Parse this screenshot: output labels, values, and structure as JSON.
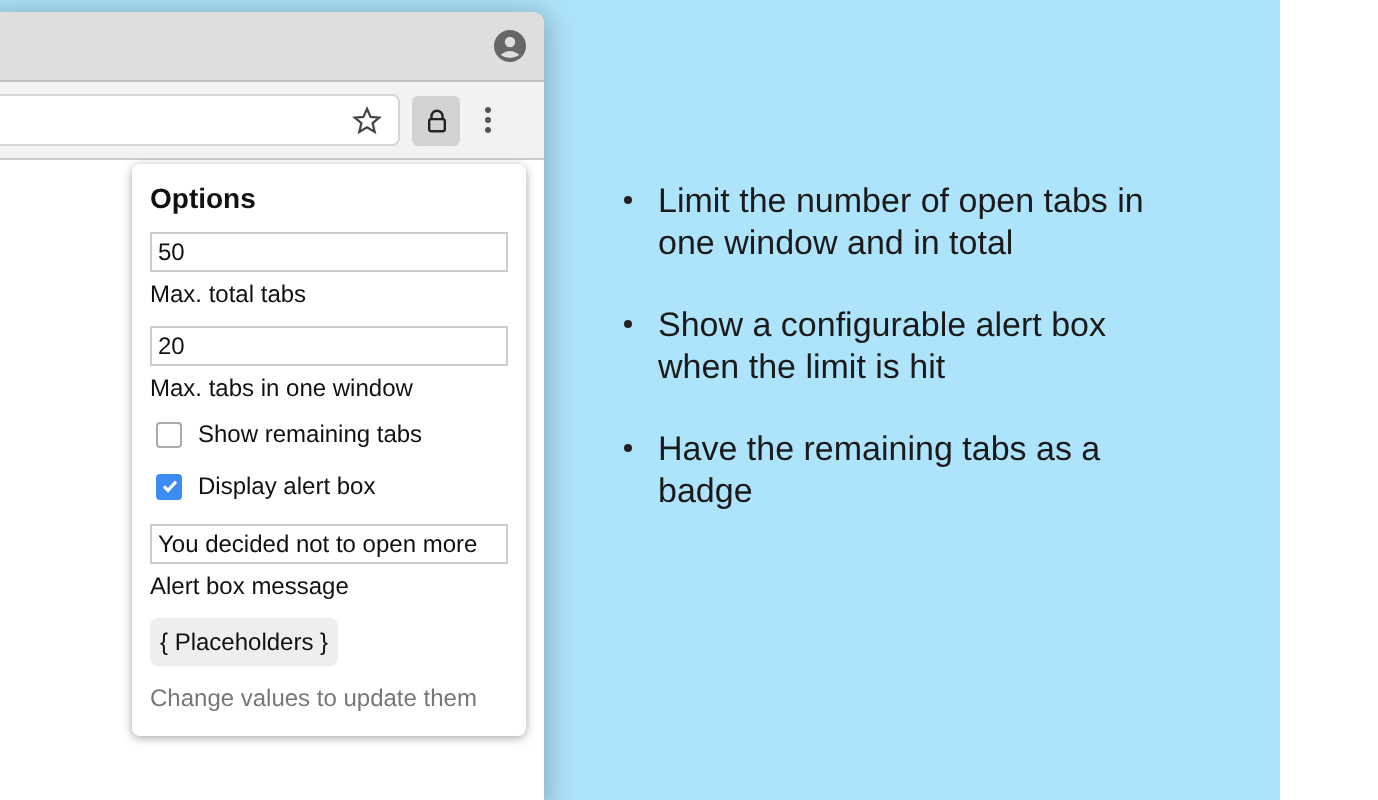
{
  "popup": {
    "title": "Options",
    "items": [
      {
        "kind": "field",
        "value": "50",
        "label": "Max. total tabs"
      },
      {
        "kind": "field",
        "value": "20",
        "label": "Max. tabs in one window"
      },
      {
        "kind": "checkbox",
        "label": "Show remaining tabs",
        "checked": false
      },
      {
        "kind": "checkbox",
        "label": "Display alert box",
        "checked": true
      },
      {
        "kind": "field",
        "value": "You decided not to open more",
        "label": "Alert box message"
      },
      {
        "kind": "button",
        "label": "{ Placeholders }"
      },
      {
        "kind": "hint",
        "label": "Change values to update them"
      }
    ]
  },
  "features": [
    "Limit the number of open tabs in one window and in total",
    "Show a configurable alert box when the limit is hit",
    "Have the remaining tabs as a badge"
  ]
}
